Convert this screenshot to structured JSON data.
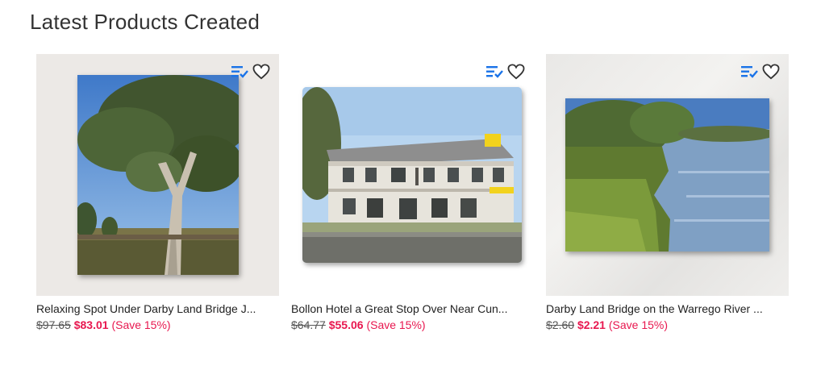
{
  "section": {
    "title": "Latest Products Created"
  },
  "products": [
    {
      "name": "Relaxing Spot Under Darby Land Bridge J...",
      "old_price": "$97.65",
      "new_price": "$83.01",
      "save": "(Save 15%)"
    },
    {
      "name": "Bollon Hotel a Great Stop Over Near Cun...",
      "old_price": "$64.77",
      "new_price": "$55.06",
      "save": "(Save 15%)"
    },
    {
      "name": "Darby Land Bridge on the Warrego River ...",
      "old_price": "$2.60",
      "new_price": "$2.21",
      "save": "(Save 15%)"
    }
  ],
  "icons": {
    "list": "add-to-list-icon",
    "favorite": "heart-icon"
  },
  "colors": {
    "sale": "#e8174f",
    "list_icon": "#1a73e8"
  }
}
